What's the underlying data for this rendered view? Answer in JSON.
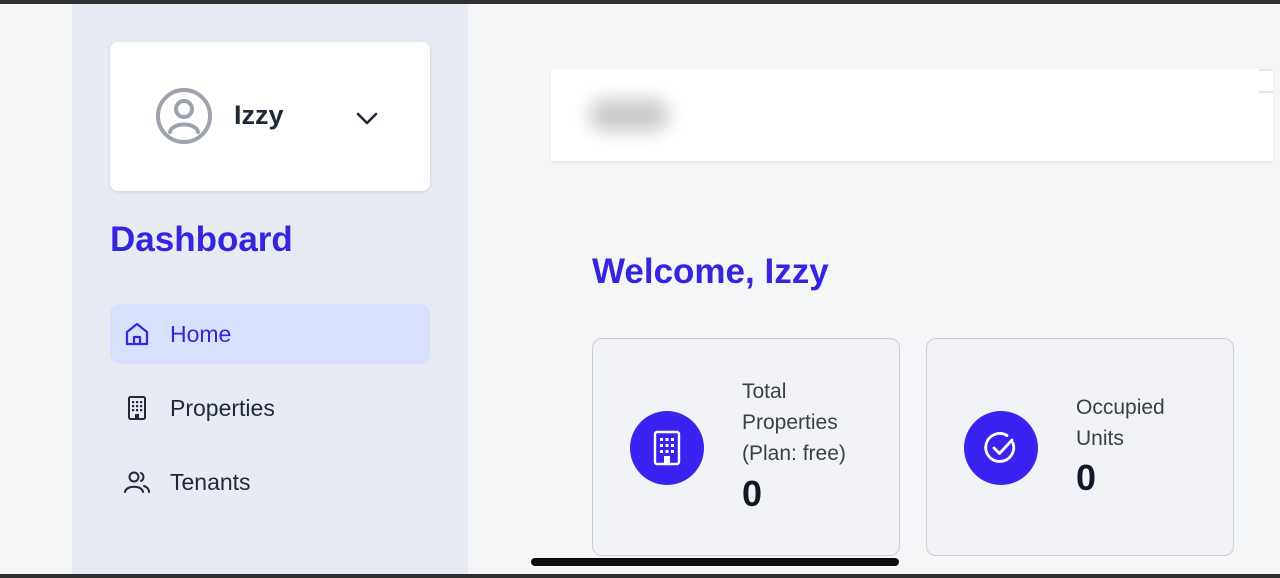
{
  "user": {
    "name": "Izzy",
    "avatar_icon": "user-circle-icon",
    "menu_icon": "chevron-down-icon"
  },
  "sidebar": {
    "title": "Dashboard",
    "items": [
      {
        "label": "Home",
        "icon": "home-icon",
        "active": true
      },
      {
        "label": "Properties",
        "icon": "building-icon",
        "active": false
      },
      {
        "label": "Tenants",
        "icon": "users-icon",
        "active": false
      }
    ]
  },
  "main": {
    "welcome": "Welcome, Izzy",
    "stats": [
      {
        "label": "Total\nProperties\n(Plan: free)",
        "value": "0",
        "icon": "building-icon"
      },
      {
        "label": "Occupied\nUnits",
        "value": "0",
        "icon": "check-circle-icon"
      }
    ]
  },
  "colors": {
    "accent": "#3426e0",
    "icon_bg": "#3a22f0",
    "sidebar_bg": "#e8ebf3",
    "active_item_bg": "#d9e0fb"
  }
}
